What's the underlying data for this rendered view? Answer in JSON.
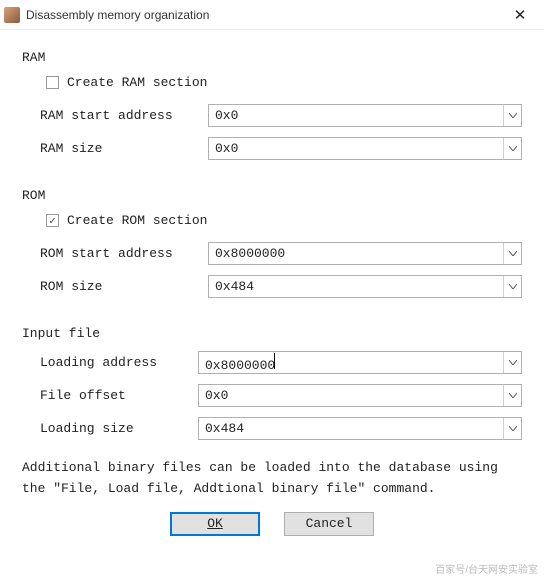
{
  "window": {
    "title": "Disassembly memory organization",
    "close_glyph": "✕"
  },
  "ram": {
    "title": "RAM",
    "create_label": "Create RAM section",
    "create_checked": false,
    "start_label": "RAM start address",
    "start_value": "0x0",
    "size_label": "RAM size",
    "size_value": "0x0"
  },
  "rom": {
    "title": "ROM",
    "create_label": "Create ROM section",
    "create_checked": true,
    "start_label": "ROM start address",
    "start_value": "0x8000000",
    "size_label": "ROM size",
    "size_value": "0x484"
  },
  "input": {
    "title": "Input file",
    "loading_addr_label": "Loading address",
    "loading_addr_value": "0x8000000",
    "offset_label": "File offset",
    "offset_value": "0x0",
    "size_label": "Loading size",
    "size_value": "0x484"
  },
  "info_text": "Additional binary files can be loaded into the database using the \"File, Load file, Addtional binary file\" command.",
  "buttons": {
    "ok": "OK",
    "cancel": "Cancel"
  },
  "check_glyph": "✓",
  "watermark": {
    "line1": "",
    "line2": "百家号/台天网安实验室"
  }
}
